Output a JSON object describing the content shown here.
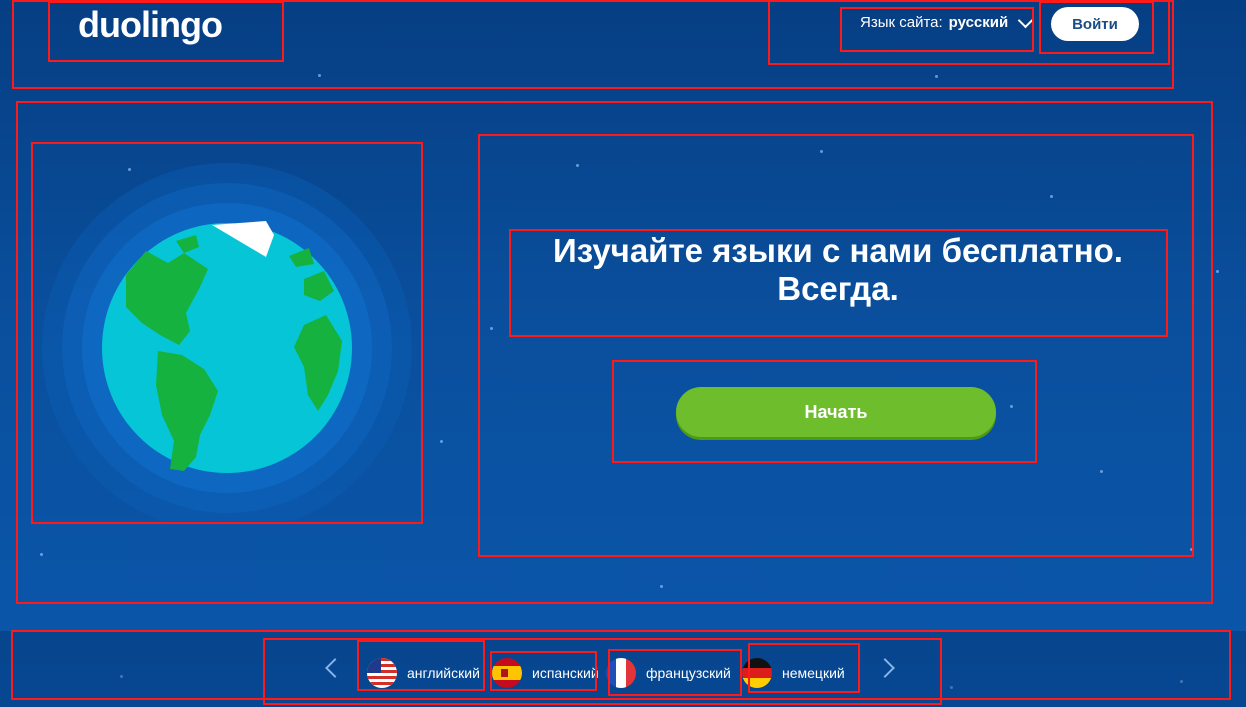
{
  "header": {
    "logo": "duolingo",
    "site_language_label": "Язык сайта:",
    "site_language_value": "русский",
    "login_button": "Войти"
  },
  "hero": {
    "headline_line1": "Изучайте языки с нами бесплатно.",
    "headline_line2": "Всегда.",
    "start_button": "Начать"
  },
  "languages": [
    {
      "label": "английский",
      "flag": "us-flag-icon"
    },
    {
      "label": "испанский",
      "flag": "spain-flag-icon"
    },
    {
      "label": "французский",
      "flag": "france-flag-icon"
    },
    {
      "label": "немецкий",
      "flag": "germany-flag-icon"
    }
  ],
  "colors": {
    "background": "#0a4f9d",
    "accent_green": "#6ebd2c",
    "annotation_red": "#ff1a1a"
  }
}
